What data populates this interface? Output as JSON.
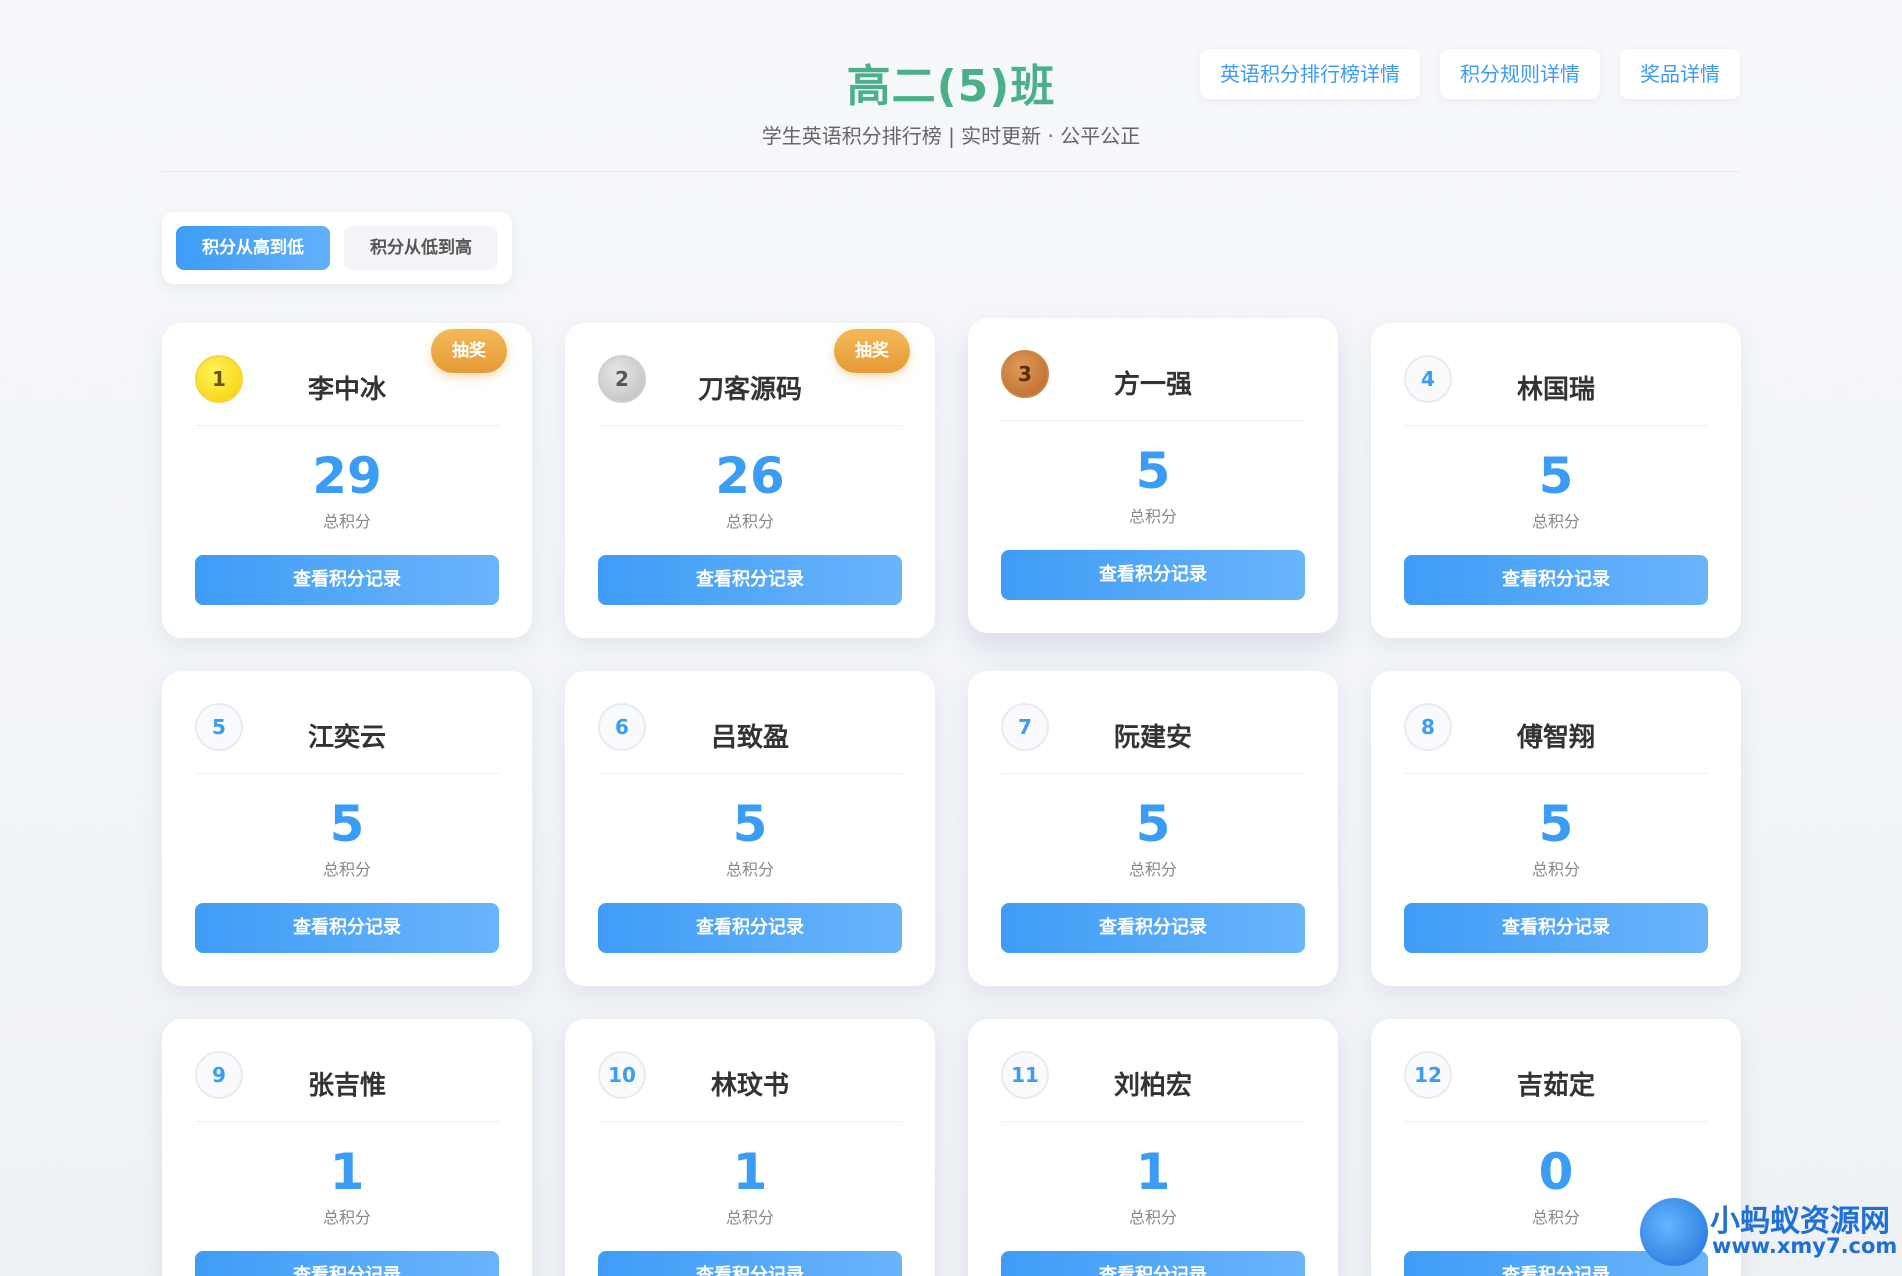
{
  "header": {
    "title": "高二(5)班",
    "subtitle": "学生英语积分排行榜 | 实时更新 · 公平公正",
    "links": [
      "英语积分排行榜详情",
      "积分规则详情",
      "奖品详情"
    ]
  },
  "sort": {
    "options": [
      "积分从高到低",
      "积分从低到高"
    ],
    "active_index": 0
  },
  "card_common": {
    "score_label": "总积分",
    "record_button": "查看积分记录",
    "lottery_badge": "抽奖"
  },
  "students": [
    {
      "rank": "1",
      "name": "李中冰",
      "score": "29",
      "lottery": true,
      "medal": "gold"
    },
    {
      "rank": "2",
      "name": "刀客源码",
      "score": "26",
      "lottery": true,
      "medal": "silver"
    },
    {
      "rank": "3",
      "name": "方一强",
      "score": "5",
      "lottery": false,
      "medal": "bronze"
    },
    {
      "rank": "4",
      "name": "林国瑞",
      "score": "5",
      "lottery": false,
      "medal": ""
    },
    {
      "rank": "5",
      "name": "江奕云",
      "score": "5",
      "lottery": false,
      "medal": ""
    },
    {
      "rank": "6",
      "name": "吕致盈",
      "score": "5",
      "lottery": false,
      "medal": ""
    },
    {
      "rank": "7",
      "name": "阮建安",
      "score": "5",
      "lottery": false,
      "medal": ""
    },
    {
      "rank": "8",
      "name": "傅智翔",
      "score": "5",
      "lottery": false,
      "medal": ""
    },
    {
      "rank": "9",
      "name": "张吉惟",
      "score": "1",
      "lottery": false,
      "medal": ""
    },
    {
      "rank": "10",
      "name": "林玟书",
      "score": "1",
      "lottery": false,
      "medal": ""
    },
    {
      "rank": "11",
      "name": "刘柏宏",
      "score": "1",
      "lottery": false,
      "medal": ""
    },
    {
      "rank": "12",
      "name": "吉茹定",
      "score": "0",
      "lottery": false,
      "medal": ""
    }
  ],
  "watermark": {
    "title": "小蚂蚁资源网",
    "url": "www.xmy7.com"
  },
  "colors": {
    "title_green": "#4caf8a",
    "accent_blue": "#3b9cf5",
    "badge_orange": "#e79a36"
  }
}
